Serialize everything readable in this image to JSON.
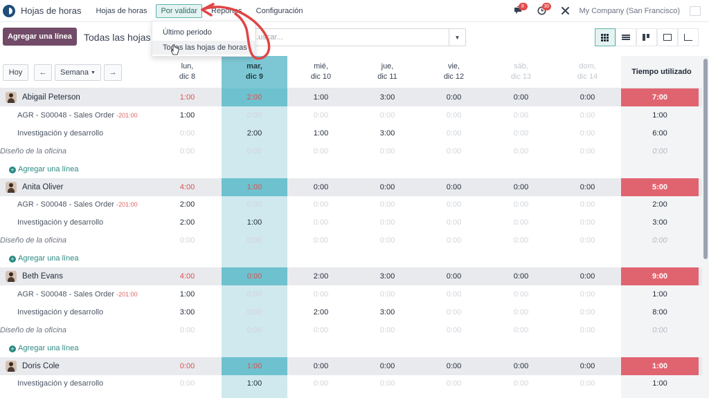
{
  "app": {
    "name": "Hojas de horas",
    "logo_icon": "timesheet-logo-icon"
  },
  "nav": {
    "items": [
      "Hojas de horas",
      "Por validar",
      "Reportes",
      "Configuración"
    ],
    "active": "Por validar"
  },
  "topbar": {
    "messages_count": "8",
    "activities_count": "30",
    "company": "My Company (San Francisco)"
  },
  "control": {
    "add_line_button": "Agregar una línea",
    "title": "Todas las hojas d",
    "search_placeholder": "...uscar..."
  },
  "dropdown": {
    "items": [
      "Último periodo",
      "Todas las hojas de horas"
    ]
  },
  "grid": {
    "today_button": "Hoy",
    "period_select": "Semana",
    "days": [
      {
        "name": "lun,",
        "date": "dic 8"
      },
      {
        "name": "mar,",
        "date": "dic 9"
      },
      {
        "name": "mié,",
        "date": "dic 10"
      },
      {
        "name": "jue,",
        "date": "dic 11"
      },
      {
        "name": "vie,",
        "date": "dic 12"
      },
      {
        "name": "sáb,",
        "date": "dic 13"
      },
      {
        "name": "dom,",
        "date": "dic 14"
      }
    ],
    "total_header": "Tiempo utilizado",
    "add_line_label": "Agregar una línea",
    "rows": [
      {
        "type": "emp",
        "label": "Abigail Peterson",
        "cells": [
          "1:00",
          "2:00",
          "1:00",
          "3:00",
          "0:00",
          "0:00",
          "0:00"
        ],
        "total": "7:00"
      },
      {
        "type": "sub",
        "label": "AGR - S00048 - Sales Order",
        "tag": "-201:00",
        "cells": [
          "1:00",
          "0:00",
          "0:00",
          "0:00",
          "0:00",
          "0:00",
          "0:00"
        ],
        "total": "1:00"
      },
      {
        "type": "sub",
        "label": "Investigación y desarrollo",
        "cells": [
          "0:00",
          "2:00",
          "1:00",
          "3:00",
          "0:00",
          "0:00",
          "0:00"
        ],
        "total": "6:00"
      },
      {
        "type": "italic",
        "label": "Diseño de la oficina",
        "cells": [
          "0:00",
          "0:00",
          "0:00",
          "0:00",
          "0:00",
          "0:00",
          "0:00"
        ],
        "total": "0:00"
      },
      {
        "type": "add"
      },
      {
        "type": "emp",
        "label": "Anita Oliver",
        "cells": [
          "4:00",
          "1:00",
          "0:00",
          "0:00",
          "0:00",
          "0:00",
          "0:00"
        ],
        "total": "5:00"
      },
      {
        "type": "sub",
        "label": "AGR - S00048 - Sales Order",
        "tag": "-201:00",
        "cells": [
          "2:00",
          "0:00",
          "0:00",
          "0:00",
          "0:00",
          "0:00",
          "0:00"
        ],
        "total": "2:00"
      },
      {
        "type": "sub",
        "label": "Investigación y desarrollo",
        "cells": [
          "2:00",
          "1:00",
          "0:00",
          "0:00",
          "0:00",
          "0:00",
          "0:00"
        ],
        "total": "3:00"
      },
      {
        "type": "italic",
        "label": "Diseño de la oficina",
        "cells": [
          "0:00",
          "0:00",
          "0:00",
          "0:00",
          "0:00",
          "0:00",
          "0:00"
        ],
        "total": "0:00"
      },
      {
        "type": "add"
      },
      {
        "type": "emp",
        "label": "Beth Evans",
        "cells": [
          "4:00",
          "0:00",
          "2:00",
          "3:00",
          "0:00",
          "0:00",
          "0:00"
        ],
        "total": "9:00"
      },
      {
        "type": "sub",
        "label": "AGR - S00048 - Sales Order",
        "tag": "-201:00",
        "cells": [
          "1:00",
          "0:00",
          "0:00",
          "0:00",
          "0:00",
          "0:00",
          "0:00"
        ],
        "total": "1:00"
      },
      {
        "type": "sub",
        "label": "Investigación y desarrollo",
        "cells": [
          "3:00",
          "0:00",
          "2:00",
          "3:00",
          "0:00",
          "0:00",
          "0:00"
        ],
        "total": "8:00"
      },
      {
        "type": "italic",
        "label": "Diseño de la oficina",
        "cells": [
          "0:00",
          "0:00",
          "0:00",
          "0:00",
          "0:00",
          "0:00",
          "0:00"
        ],
        "total": "0:00"
      },
      {
        "type": "add"
      },
      {
        "type": "emp",
        "label": "Doris Cole",
        "cells": [
          "0:00",
          "1:00",
          "0:00",
          "0:00",
          "0:00",
          "0:00",
          "0:00"
        ],
        "total": "1:00"
      },
      {
        "type": "sub",
        "label": "Investigación y desarrollo",
        "cells": [
          "0:00",
          "1:00",
          "0:00",
          "0:00",
          "0:00",
          "0:00",
          "0:00"
        ],
        "total": "1:00"
      }
    ]
  },
  "colors": {
    "primary": "#714b67",
    "accent": "#2b8a83",
    "today": "#7dc7d4",
    "overtime": "#e06470",
    "arrow": "#e04545"
  }
}
